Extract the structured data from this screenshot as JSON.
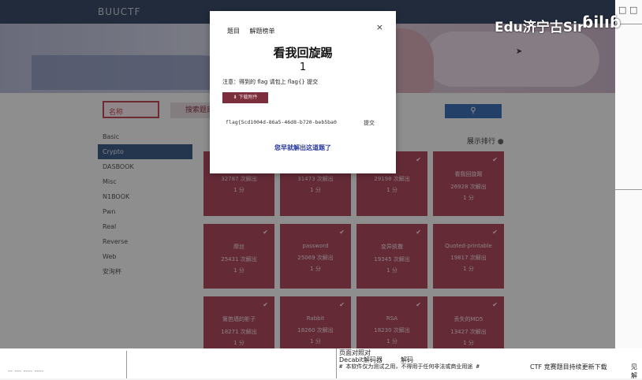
{
  "navbar": {
    "brand": "BUUCTF"
  },
  "window_controls": [
    "□",
    "□"
  ],
  "watermark": {
    "text": "Edu济宁古Sir",
    "logo": "bilibili"
  },
  "search": {
    "placeholder": "名称",
    "button_label": "搜索题目"
  },
  "categories": [
    "Basic",
    "Crypto",
    "DASBOOK",
    "Misc",
    "N1BOOK",
    "Pwn",
    "Real",
    "Reverse",
    "Web",
    "安洵杯"
  ],
  "active_category": "Crypto",
  "ranking_link": "展示排行",
  "cards": [
    {
      "title": "",
      "solves": "32787 次解出",
      "points": "1 分"
    },
    {
      "title": "",
      "solves": "31473 次解出",
      "points": "1 分"
    },
    {
      "title": "",
      "solves": "29198 次解出",
      "points": "1 分"
    },
    {
      "title": "看我回旋踢",
      "solves": "26928 次解出",
      "points": "1 分"
    },
    {
      "title": "摩丝",
      "solves": "25431 次解出",
      "points": "1 分"
    },
    {
      "title": "password",
      "solves": "25069 次解出",
      "points": "1 分"
    },
    {
      "title": "变异凯撒",
      "solves": "19345 次解出",
      "points": "1 分"
    },
    {
      "title": "Quoted-printable",
      "solves": "19817 次解出",
      "points": "1 分"
    },
    {
      "title": "篱笆墙的影子",
      "solves": "18271 次解出",
      "points": "1 分"
    },
    {
      "title": "Rabbit",
      "solves": "18260 次解出",
      "points": "1 分"
    },
    {
      "title": "RSA",
      "solves": "18230 次解出",
      "points": "1 分"
    },
    {
      "title": "丢失的MD5",
      "solves": "13427 次解出",
      "points": "1 分"
    }
  ],
  "modal": {
    "tab1": "题目",
    "tab2": "解题榜单",
    "close": "×",
    "title": "看我回旋踢",
    "score": "1",
    "note": "注意：得到的 flag 请包上 flag{} 提交",
    "attachment": "下载附件",
    "flag_value": "flag{5cd1004d-86a5-46d8-b720-beb5ba0",
    "submit": "提交",
    "solved_text": "您早就解出这道题了"
  },
  "bottom": {
    "dash": "-- --- ---- ----",
    "note1": "页面对照对",
    "note2": "Decabit解码器",
    "note3": "解码",
    "note4": "# 本软件仅为测试之用，不得用于任何非法或商业用途 #",
    "note5": "CTF 竞赛题目持续更新下载",
    "note6": "见解"
  }
}
